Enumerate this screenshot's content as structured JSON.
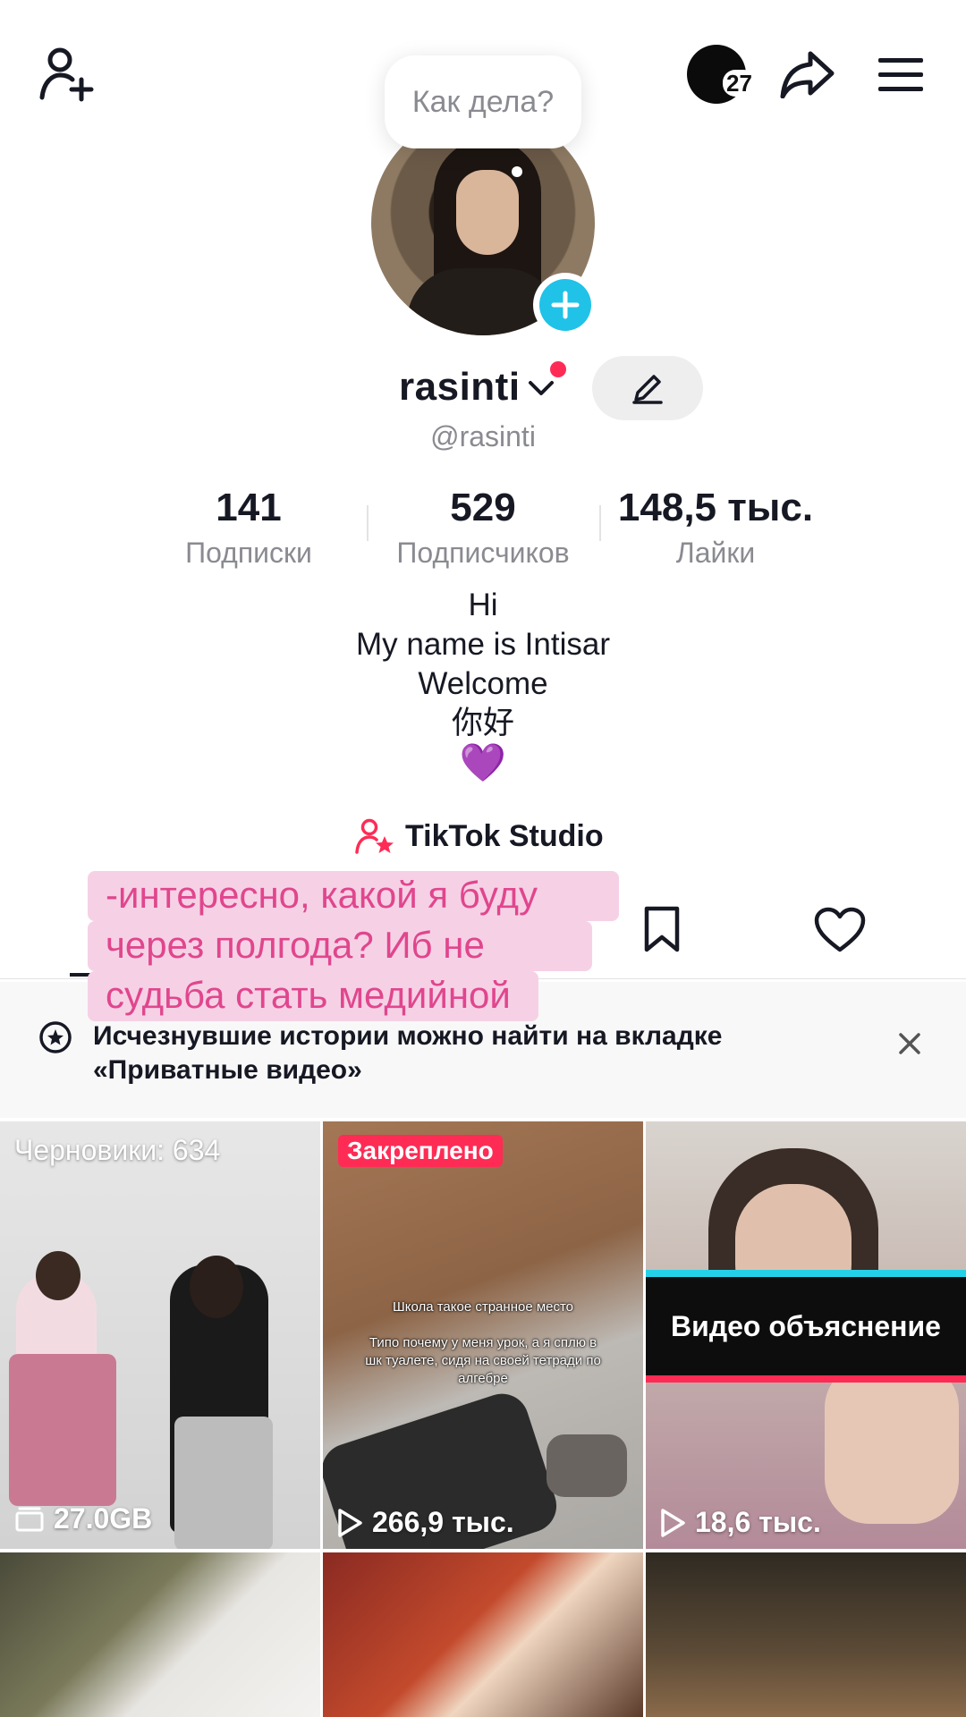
{
  "header": {
    "add_friend_icon": "person-plus-icon",
    "notification_count": "27",
    "share_icon": "share-arrow-icon",
    "menu_icon": "hamburger-menu-icon"
  },
  "bubble": {
    "text": "Как дела?"
  },
  "profile": {
    "username": "rasinti",
    "handle": "@rasinti"
  },
  "stats": [
    {
      "value": "141",
      "label": "Подписки"
    },
    {
      "value": "529",
      "label": "Подписчиков"
    },
    {
      "value": "148,5 тыс.",
      "label": "Лайки"
    }
  ],
  "bio": {
    "line1": "Hi",
    "line2": "My name is Intisar",
    "line3": "Welcome",
    "line4": "你好",
    "line5": "💜"
  },
  "studio": {
    "label": "TikTok Studio"
  },
  "sticker": {
    "line1": "-интересно, какой я буду",
    "line2": "через полгода? Иб не",
    "line3": "судьба стать медийной"
  },
  "notice": {
    "text": "Исчезнувшие истории можно найти на вкладке «Приватные видео»"
  },
  "grid": {
    "drafts_label": "Черновики: 634",
    "drafts_size": "27.0GB",
    "pinned_label": "Закреплено",
    "tile2_caption": "Школа такое странное место\n\nТипо почему у меня урок, а я сплю в шк туалете, сидя на своей тетради по алгебре",
    "tile2_views": "266,9 тыс.",
    "tile3_banner": "Видео объяснение",
    "tile3_views": "18,6 тыс."
  },
  "colors": {
    "accent_red": "#fe2c55",
    "accent_cyan": "#20c2e8",
    "sticker_bg": "#f6d1e6",
    "sticker_text": "#e0468d"
  }
}
